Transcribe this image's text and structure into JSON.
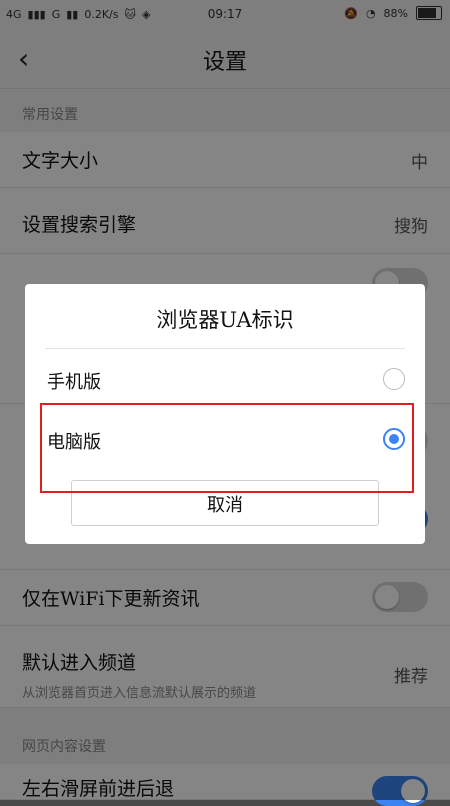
{
  "status_bar": {
    "network": "4G",
    "network2": "G",
    "speed": "0.2K/s",
    "time": "09:17",
    "battery": "88%",
    "battery_level": 0.88
  },
  "header": {
    "title": "设置",
    "back_icon": "chevron-left-icon"
  },
  "sections": {
    "common": "常用设置",
    "web_content": "网页内容设置"
  },
  "rows": {
    "font_size": {
      "title": "文字大小",
      "value": "中"
    },
    "search_engine": {
      "title": "设置搜索引擎",
      "value": "搜狗"
    },
    "wifi_update": {
      "title": "仅在WiFi下更新资讯",
      "toggle_on": false
    },
    "default_channel": {
      "title": "默认进入频道",
      "desc": "从浏览器首页进入信息流默认展示的频道",
      "value": "推荐"
    },
    "swipe_nav": {
      "title": "左右滑屏前进后退",
      "toggle_on": true
    }
  },
  "dialog": {
    "title": "浏览器UA标识",
    "options": [
      {
        "label": "手机版",
        "selected": false
      },
      {
        "label": "电脑版",
        "selected": true
      }
    ],
    "cancel": "取消"
  },
  "colors": {
    "accent": "#3b84f2",
    "highlight": "#e02020"
  }
}
